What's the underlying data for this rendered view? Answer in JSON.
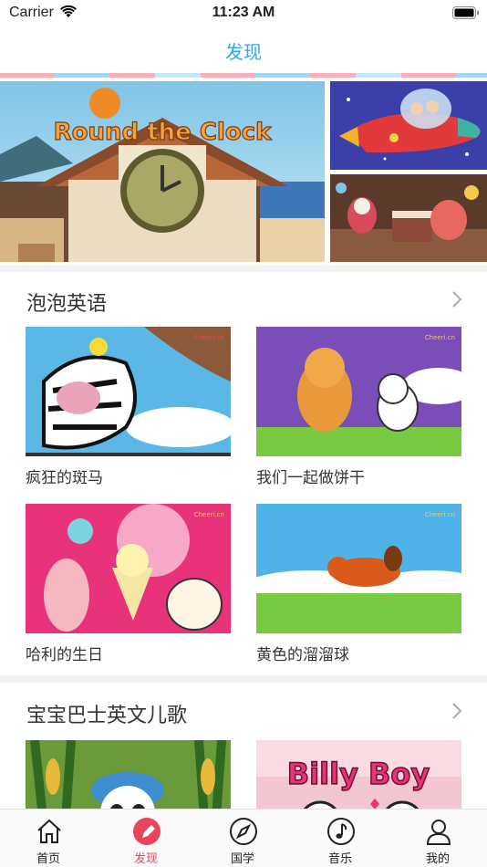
{
  "status_bar": {
    "carrier": "Carrier",
    "time": "11:23 AM"
  },
  "nav": {
    "title": "发现"
  },
  "banner": {
    "main_caption": "Round the Clock",
    "items": [
      "round-the-clock-banner",
      "rocket-banner",
      "birthday-cake-banner"
    ]
  },
  "sections": [
    {
      "title": "泡泡英语",
      "cards": [
        {
          "title": "疯狂的斑马",
          "brand": "Cheeri.cn"
        },
        {
          "title": "我们一起做饼干",
          "brand": "Cheeri.cn"
        },
        {
          "title": "哈利的生日",
          "brand": "Cheeri.cn"
        },
        {
          "title": "黄色的溜溜球",
          "brand": "Cheeri.cn"
        }
      ]
    },
    {
      "title": "宝宝巴士英文儿歌",
      "cards": [
        {
          "title": "",
          "caption": ""
        },
        {
          "title": "",
          "caption": "Billy Boy"
        }
      ]
    }
  ],
  "tabs": [
    {
      "label": "首页",
      "icon": "home-icon",
      "active": false
    },
    {
      "label": "发现",
      "icon": "discover-icon",
      "active": true
    },
    {
      "label": "国学",
      "icon": "compass-icon",
      "active": false
    },
    {
      "label": "音乐",
      "icon": "music-note-icon",
      "active": false
    },
    {
      "label": "我的",
      "icon": "profile-icon",
      "active": false
    }
  ],
  "colors": {
    "accent": "#2fa9e6",
    "active_tab": "#e8455f",
    "divider": "#f3f3f3"
  }
}
